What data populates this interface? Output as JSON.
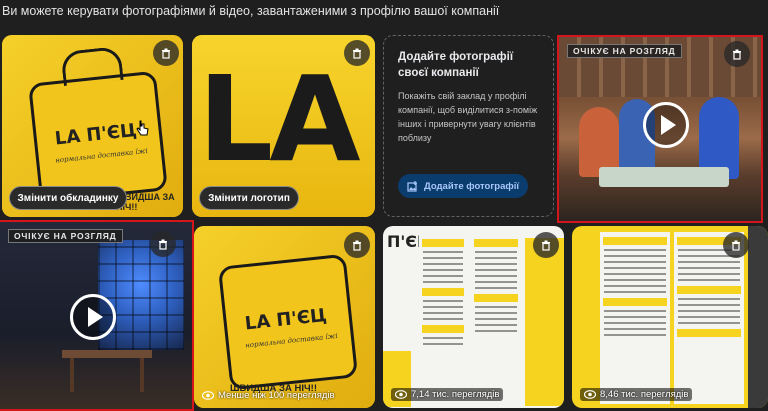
{
  "header": {
    "text": "Ви можете керувати фотографіями й відео, завантаженими з профілю вашої компанії"
  },
  "cover": {
    "change_button": "Змінити обкладинку",
    "bag_logo": "LA П'ЄЦ",
    "bag_sub": "нормальна доставка їжі",
    "bag_bottom": "ШВИДША ЗА НІЧ!!"
  },
  "logo_tile": {
    "logo_text": "LA",
    "change_button": "Змінити логотип"
  },
  "add_card": {
    "title": "Додайте фотографії своєї компанії",
    "body": "Покажіть свій заклад у профілі компанії, щоб виділитися з-поміж інших і привернути увагу клієнтів поблизу",
    "button": "Додайте фотографії"
  },
  "video1": {
    "status": "ОЧІКУЄ НА РОЗГЛЯД"
  },
  "video2": {
    "status": "ОЧІКУЄ НА РОЗГЛЯД"
  },
  "photo_bag2": {
    "bag_logo": "LA П'ЄЦ",
    "bag_sub": "нормальна доставка їжі",
    "bag_bottom": "ШВИДША ЗА НІЧ!!",
    "views": "Менше ніж 100 переглядів"
  },
  "menu1": {
    "title": "П'ЄЦ",
    "views": "7,14 тис. переглядів"
  },
  "menu2": {
    "views": "8,46 тис. переглядів"
  },
  "colors": {
    "accent_blue": "#1a73e8",
    "button_dark": "#0b3c6e",
    "flag_red": "#d4161c",
    "yellow": "#f5d31e"
  },
  "icons": [
    "trash-icon",
    "play-icon",
    "eye-icon",
    "add-photo-icon",
    "cursor-icon"
  ]
}
